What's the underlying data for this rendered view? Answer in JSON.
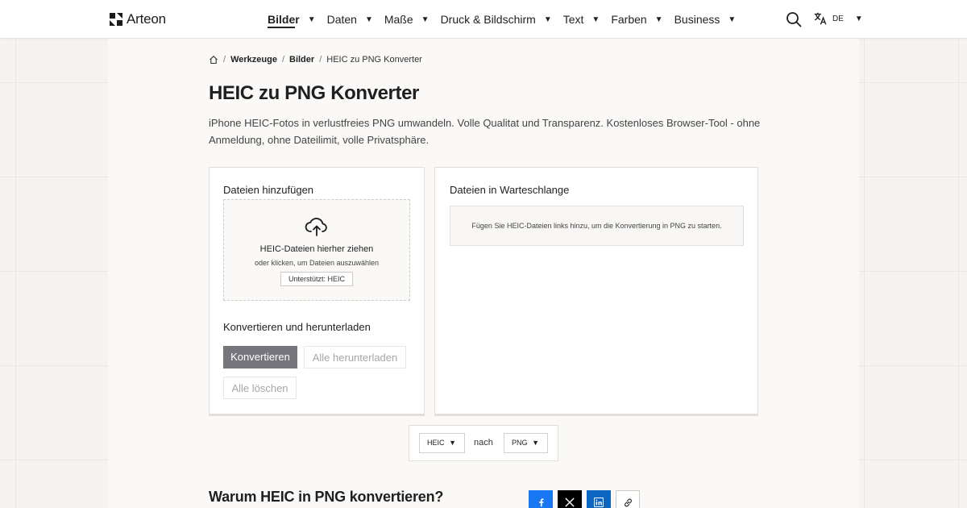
{
  "brand": {
    "name": "Arteon"
  },
  "nav": {
    "items": [
      {
        "label": "Bilder",
        "active": true
      },
      {
        "label": "Daten"
      },
      {
        "label": "Maße"
      },
      {
        "label": "Druck & Bildschirm"
      },
      {
        "label": "Text"
      },
      {
        "label": "Farben"
      },
      {
        "label": "Business"
      }
    ],
    "caret": "▼",
    "search_icon": "search-icon",
    "language": {
      "code": "DE",
      "icon": "translate-icon"
    }
  },
  "breadcrumb": {
    "home_icon": "home-icon",
    "separator": "/",
    "items": [
      "Werkzeuge",
      "Bilder"
    ],
    "current": "HEIC zu PNG Konverter"
  },
  "page": {
    "title": "HEIC zu PNG Konverter",
    "description": "iPhone HEIC-Fotos in verlustfreies PNG umwandeln. Volle Qualitat und Transparenz. Kostenloses Browser-Tool - ohne Anmeldung, ohne Dateilimit, volle Privatsphäre."
  },
  "upload": {
    "title": "Dateien hinzufügen",
    "drop_title": "HEIC-Dateien hierher ziehen",
    "drop_sub": "oder klicken, um Dateien auszuwählen",
    "supported": "Unterstützt: HEIC",
    "icon": "cloud-upload-icon"
  },
  "actions": {
    "title": "Konvertieren und herunterladen",
    "convert": "Konvertieren",
    "download_all": "Alle herunterladen",
    "clear_all": "Alle löschen"
  },
  "queue": {
    "title": "Dateien in Warteschlange",
    "empty": "Fügen Sie HEIC-Dateien links hinzu, um die Konvertierung in PNG zu starten."
  },
  "format": {
    "from": "HEIC",
    "connector": "nach",
    "to": "PNG",
    "caret": "▼"
  },
  "why": {
    "title": "Warum HEIC in PNG konvertieren?"
  },
  "share": {
    "facebook": "facebook-icon",
    "x": "x-icon",
    "linkedin": "linkedin-icon",
    "link": "link-icon"
  },
  "colors": {
    "primary_button": "#76757c",
    "facebook": "#1877f2",
    "x": "#000000",
    "linkedin": "#0a66c2"
  }
}
